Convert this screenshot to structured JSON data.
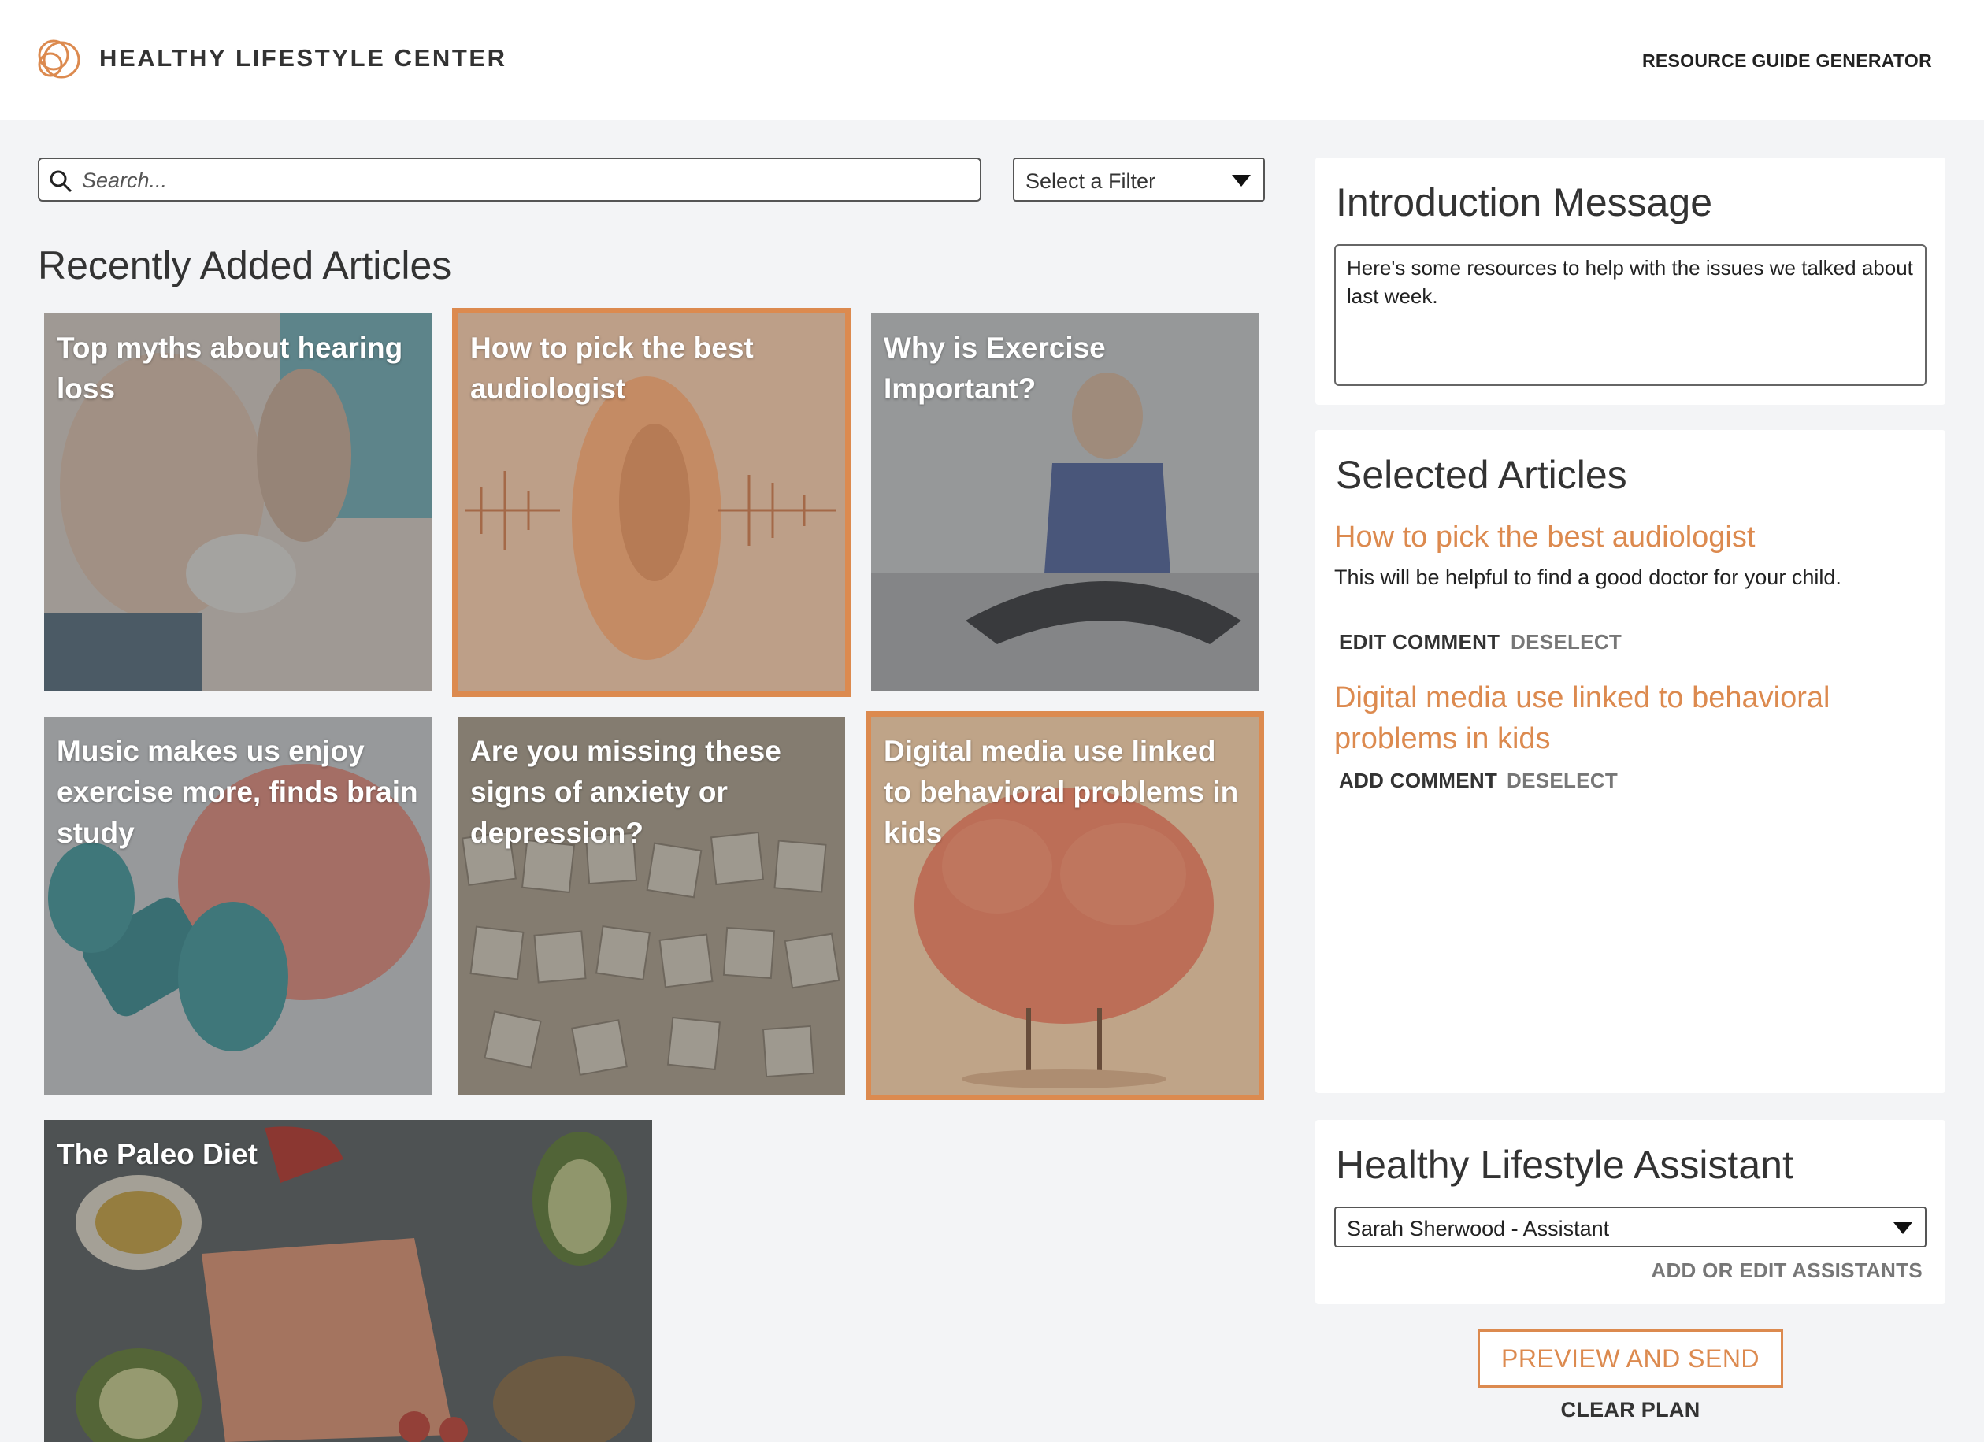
{
  "brand": {
    "name": "HEALTHY LIFESTYLE CENTER",
    "accent": "#dc8a4f"
  },
  "nav": {
    "resource_guide": "RESOURCE GUIDE GENERATOR"
  },
  "search": {
    "placeholder": "Search...",
    "icon": "search-icon"
  },
  "filter": {
    "selected": "Select a Filter"
  },
  "articles": {
    "heading": "Recently Added Articles",
    "items": [
      {
        "title": "Top myths about hearing loss",
        "selected": false
      },
      {
        "title": "How to pick the best audiologist",
        "selected": true
      },
      {
        "title": "Why is Exercise Important?",
        "selected": false
      },
      {
        "title": "Music makes us enjoy exercise more, finds brain study",
        "selected": false
      },
      {
        "title": "Are you missing these signs of anxiety or depression?",
        "selected": false
      },
      {
        "title": "Digital media use linked to behavioral problems in kids",
        "selected": true
      },
      {
        "title": "The Paleo Diet",
        "selected": false
      }
    ]
  },
  "intro": {
    "heading": "Introduction Message",
    "message": "Here's some resources to help with the issues we talked about last week."
  },
  "selected": {
    "heading": "Selected Articles",
    "items": [
      {
        "title": "How to pick the best audiologist",
        "comment": "This will be helpful to find a good doctor for your child.",
        "comment_action": "EDIT COMMENT",
        "deselect": "DESELECT"
      },
      {
        "title": "Digital media use linked to behavioral problems in kids",
        "comment": "",
        "comment_action": "ADD COMMENT",
        "deselect": "DESELECT"
      }
    ]
  },
  "assistant": {
    "heading": "Healthy Lifestyle Assistant",
    "selected": "Sarah Sherwood - Assistant",
    "manage": "ADD OR EDIT ASSISTANTS"
  },
  "actions": {
    "preview": "PREVIEW AND SEND",
    "clear": "CLEAR PLAN"
  }
}
